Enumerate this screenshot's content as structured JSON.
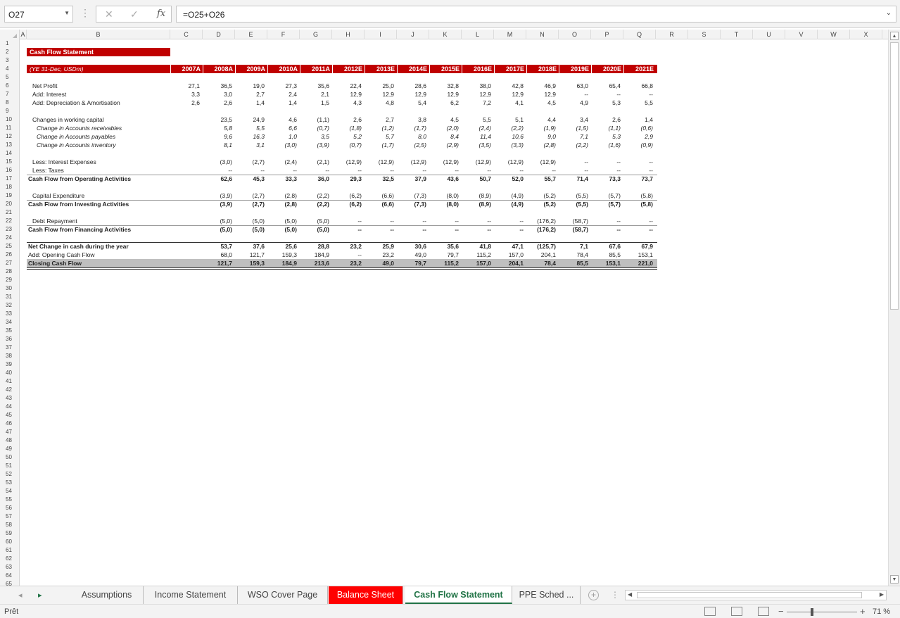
{
  "formula_bar": {
    "cell_ref": "O27",
    "formula": "=O25+O26",
    "fx": "fx"
  },
  "columns": [
    "A",
    "B",
    "C",
    "D",
    "E",
    "F",
    "G",
    "H",
    "I",
    "J",
    "K",
    "L",
    "M",
    "N",
    "O",
    "P",
    "Q",
    "R",
    "S",
    "T",
    "U",
    "V",
    "W",
    "X"
  ],
  "rows": [
    "1",
    "2",
    "3",
    "4",
    "5",
    "6",
    "7",
    "8",
    "9",
    "10",
    "11",
    "12",
    "13",
    "14",
    "15",
    "16",
    "17",
    "18",
    "19",
    "20",
    "21",
    "22",
    "23",
    "24",
    "25",
    "26",
    "27",
    "28",
    "29",
    "30",
    "31",
    "32",
    "33",
    "34",
    "35",
    "36",
    "37",
    "38",
    "39",
    "40",
    "41",
    "42",
    "43",
    "44",
    "45",
    "46",
    "47",
    "48",
    "49",
    "50",
    "51",
    "52",
    "53",
    "54",
    "55",
    "56",
    "57",
    "58",
    "59",
    "60",
    "61",
    "62",
    "63",
    "64",
    "65"
  ],
  "sheet": {
    "title": "Cash Flow Statement",
    "period_label": "(YE 31-Dec, USDm)",
    "years": [
      "2007A",
      "2008A",
      "2009A",
      "2010A",
      "2011A",
      "2012E",
      "2013E",
      "2014E",
      "2015E",
      "2016E",
      "2017E",
      "2018E",
      "2019E",
      "2020E",
      "2021E"
    ],
    "lines": [
      {
        "label": "Net Profit",
        "indent": 2,
        "style": "",
        "values": [
          "27,1",
          "36,5",
          "19,0",
          "27,3",
          "35,6",
          "22,4",
          "25,0",
          "28,6",
          "32,8",
          "38,0",
          "42,8",
          "46,9",
          "63,0",
          "65,4",
          "66,8"
        ]
      },
      {
        "label": "Add: Interest",
        "indent": 2,
        "style": "",
        "values": [
          "3,3",
          "3,0",
          "2,7",
          "2,4",
          "2,1",
          "12,9",
          "12,9",
          "12,9",
          "12,9",
          "12,9",
          "12,9",
          "12,9",
          "--",
          "--",
          "--"
        ]
      },
      {
        "label": "Add: Depreciation & Amortisation",
        "indent": 2,
        "style": "",
        "values": [
          "2,6",
          "2,6",
          "1,4",
          "1,4",
          "1,5",
          "4,3",
          "4,8",
          "5,4",
          "6,2",
          "7,2",
          "4,1",
          "4,5",
          "4,9",
          "5,3",
          "5,5"
        ]
      },
      {
        "label": "Changes in working capital",
        "indent": 2,
        "style": "",
        "values": [
          "",
          "23,5",
          "24,9",
          "4,6",
          "(1,1)",
          "2,6",
          "2,7",
          "3,8",
          "4,5",
          "5,5",
          "5,1",
          "4,4",
          "3,4",
          "2,6",
          "1,4"
        ]
      },
      {
        "label": "Change in Accounts receivables",
        "indent": 4,
        "style": "it",
        "values": [
          "",
          "5,8",
          "5,5",
          "6,6",
          "(0,7)",
          "(1,8)",
          "(1,2)",
          "(1,7)",
          "(2,0)",
          "(2,4)",
          "(2,2)",
          "(1,9)",
          "(1,5)",
          "(1,1)",
          "(0,6)"
        ]
      },
      {
        "label": "Change in Accounts payables",
        "indent": 4,
        "style": "it",
        "values": [
          "",
          "9,6",
          "16,3",
          "1,0",
          "3,5",
          "5,2",
          "5,7",
          "8,0",
          "8,4",
          "11,4",
          "10,6",
          "9,0",
          "7,1",
          "5,3",
          "2,9"
        ]
      },
      {
        "label": "Change in Accounts inventory",
        "indent": 4,
        "style": "it",
        "values": [
          "",
          "8,1",
          "3,1",
          "(3,0)",
          "(3,9)",
          "(0,7)",
          "(1,7)",
          "(2,5)",
          "(2,9)",
          "(3,5)",
          "(3,3)",
          "(2,8)",
          "(2,2)",
          "(1,6)",
          "(0,9)"
        ]
      },
      {
        "label": "Less: Interest Expenses",
        "indent": 2,
        "style": "",
        "values": [
          "",
          "(3,0)",
          "(2,7)",
          "(2,4)",
          "(2,1)",
          "(12,9)",
          "(12,9)",
          "(12,9)",
          "(12,9)",
          "(12,9)",
          "(12,9)",
          "(12,9)",
          "--",
          "--",
          "--"
        ]
      },
      {
        "label": "Less: Taxes",
        "indent": 2,
        "style": "",
        "values": [
          "",
          "--",
          "--",
          "--",
          "--",
          "--",
          "--",
          "--",
          "--",
          "--",
          "--",
          "--",
          "--",
          "--",
          "--"
        ]
      },
      {
        "label": "Cash Flow from Operating Activities",
        "indent": 0,
        "style": "b",
        "values": [
          "",
          "62,6",
          "45,3",
          "33,3",
          "36,0",
          "29,3",
          "32,5",
          "37,9",
          "43,6",
          "50,7",
          "52,0",
          "55,7",
          "71,4",
          "73,3",
          "73,7"
        ]
      },
      {
        "label": "Capital Expenditure",
        "indent": 2,
        "style": "",
        "values": [
          "",
          "(3,9)",
          "(2,7)",
          "(2,8)",
          "(2,2)",
          "(6,2)",
          "(6,6)",
          "(7,3)",
          "(8,0)",
          "(8,9)",
          "(4,9)",
          "(5,2)",
          "(5,5)",
          "(5,7)",
          "(5,8)"
        ]
      },
      {
        "label": "Cash Flow from Investing Activities",
        "indent": 0,
        "style": "b",
        "values": [
          "",
          "(3,9)",
          "(2,7)",
          "(2,8)",
          "(2,2)",
          "(6,2)",
          "(6,6)",
          "(7,3)",
          "(8,0)",
          "(8,9)",
          "(4,9)",
          "(5,2)",
          "(5,5)",
          "(5,7)",
          "(5,8)"
        ]
      },
      {
        "label": "Debt Repayment",
        "indent": 2,
        "style": "",
        "values": [
          "",
          "(5,0)",
          "(5,0)",
          "(5,0)",
          "(5,0)",
          "--",
          "--",
          "--",
          "--",
          "--",
          "--",
          "(176,2)",
          "(58,7)",
          "--",
          "--"
        ]
      },
      {
        "label": "Cash Flow from Financing Activities",
        "indent": 0,
        "style": "b",
        "values": [
          "",
          "(5,0)",
          "(5,0)",
          "(5,0)",
          "(5,0)",
          "--",
          "--",
          "--",
          "--",
          "--",
          "--",
          "(176,2)",
          "(58,7)",
          "--",
          "--"
        ]
      },
      {
        "label": "Net Change in cash during the year",
        "indent": 0,
        "style": "b",
        "values": [
          "",
          "53,7",
          "37,6",
          "25,6",
          "28,8",
          "23,2",
          "25,9",
          "30,6",
          "35,6",
          "41,8",
          "47,1",
          "(125,7)",
          "7,1",
          "67,6",
          "67,9"
        ]
      },
      {
        "label": "Add: Opening Cash Flow",
        "indent": 0,
        "style": "",
        "values": [
          "",
          "68,0",
          "121,7",
          "159,3",
          "184,9",
          "--",
          "23,2",
          "49,0",
          "79,7",
          "115,2",
          "157,0",
          "204,1",
          "78,4",
          "85,5",
          "153,1"
        ]
      },
      {
        "label": "Closing Cash Flow",
        "indent": 0,
        "style": "b",
        "values": [
          "",
          "121,7",
          "159,3",
          "184,9",
          "213,6",
          "23,2",
          "49,0",
          "79,7",
          "115,2",
          "157,0",
          "204,1",
          "78,4",
          "85,5",
          "153,1",
          "221,0"
        ]
      }
    ]
  },
  "tabs": [
    {
      "label": "Assumptions",
      "style": ""
    },
    {
      "label": "Income Statement",
      "style": ""
    },
    {
      "label": "WSO Cover Page",
      "style": ""
    },
    {
      "label": "Balance Sheet",
      "style": "red"
    },
    {
      "label": "Cash Flow Statement",
      "style": "active"
    },
    {
      "label": "PPE Sched ...",
      "style": ""
    }
  ],
  "status": {
    "text": "Prêt",
    "zoom": "71 %",
    "zoom_level": 0.71
  }
}
